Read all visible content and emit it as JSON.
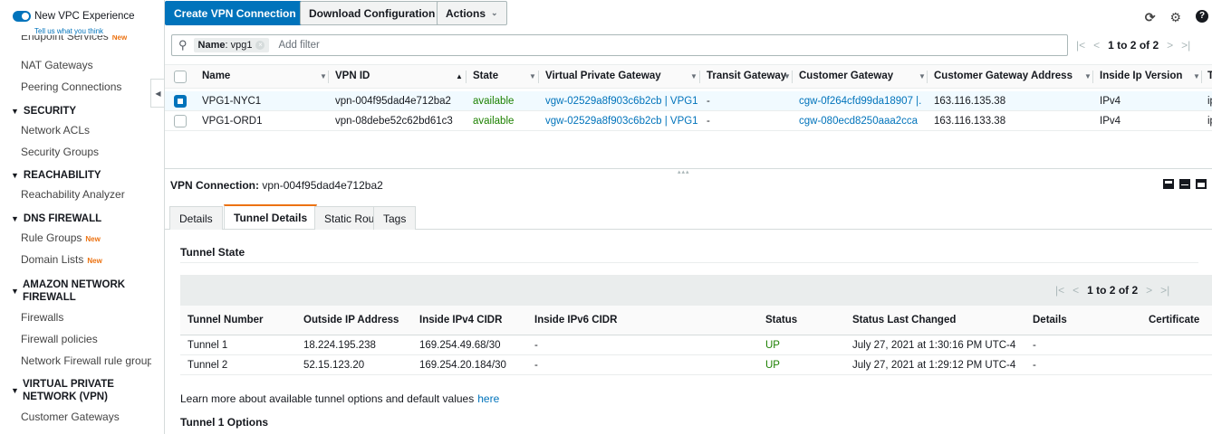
{
  "sidebar": {
    "vpc_toggle_label": "New VPC Experience",
    "feedback_link": "Tell us what you think",
    "cut_item": "Endpoint Services",
    "new_badge": "New",
    "nat_gateways": "NAT Gateways",
    "peering": "Peering Connections",
    "security": "SECURITY",
    "network_acls": "Network ACLs",
    "security_groups": "Security Groups",
    "reachability": "REACHABILITY",
    "reachability_analyzer": "Reachability Analyzer",
    "dns_firewall": "DNS FIREWALL",
    "rule_groups": "Rule Groups",
    "domain_lists": "Domain Lists",
    "network_firewall_line1": "AMAZON NETWORK",
    "network_firewall_line2": "FIREWALL",
    "firewalls": "Firewalls",
    "firewall_policies": "Firewall policies",
    "nf_rule_groups": "Network Firewall rule groups",
    "vpn_line1": "VIRTUAL PRIVATE",
    "vpn_line2": "NETWORK (VPN)",
    "customer_gateways": "Customer Gateways"
  },
  "toolbar": {
    "create": "Create VPN Connection",
    "download": "Download Configuration",
    "actions": "Actions"
  },
  "filter": {
    "token_key": "Name",
    "token_value": ": vpg1",
    "placeholder": "Add filter"
  },
  "pager_top": "1 to 2 of 2",
  "columns": {
    "name": "Name",
    "vpn_id": "VPN ID",
    "state": "State",
    "vgw": "Virtual Private Gateway",
    "tgw": "Transit Gateway",
    "cgw": "Customer Gateway",
    "cgw_addr": "Customer Gateway Address",
    "inside_ip": "Inside Ip Version",
    "t_cut": "T"
  },
  "rows": [
    {
      "name": "VPG1-NYC1",
      "vpn_id": "vpn-004f95dad4e712ba2",
      "state": "available",
      "vgw": "vgw-02529a8f903c6b2cb | VPG1",
      "tgw": "-",
      "cgw": "cgw-0f264cfd99da18907 |...",
      "cgw_addr": "163.116.135.38",
      "inside_ip": "IPv4",
      "t_cut": "ip"
    },
    {
      "name": "VPG1-ORD1",
      "vpn_id": "vpn-08debe52c62bd61c3",
      "state": "available",
      "vgw": "vgw-02529a8f903c6b2cb | VPG1",
      "tgw": "-",
      "cgw": "cgw-080ecd8250aaa2cca ...",
      "cgw_addr": "163.116.133.38",
      "inside_ip": "IPv4",
      "t_cut": "ip"
    }
  ],
  "detail": {
    "label": "VPN Connection:",
    "value": "vpn-004f95dad4e712ba2",
    "tabs": [
      "Details",
      "Tunnel Details",
      "Static Routes",
      "Tags"
    ],
    "tunnel_state": "Tunnel State",
    "pager": "1 to 2 of 2",
    "tunnel_cols": [
      "Tunnel Number",
      "Outside IP Address",
      "Inside IPv4 CIDR",
      "Inside IPv6 CIDR",
      "Status",
      "Status Last Changed",
      "Details",
      "Certificate"
    ],
    "tunnels": [
      {
        "number": "Tunnel 1",
        "outside_ip": "18.224.195.238",
        "inside_v4": "169.254.49.68/30",
        "inside_v6": "-",
        "status": "UP",
        "changed": "July 27, 2021 at 1:30:16 PM UTC-4",
        "details": "-"
      },
      {
        "number": "Tunnel 2",
        "outside_ip": "52.15.123.20",
        "inside_v4": "169.254.20.184/30",
        "inside_v6": "-",
        "status": "UP",
        "changed": "July 27, 2021 at 1:29:12 PM UTC-4",
        "details": "-"
      }
    ],
    "learn_more": "Learn more about available tunnel options and default values",
    "here": "here",
    "options_heading": "Tunnel 1 Options"
  },
  "colors": {
    "accent": "#0073bb",
    "tab_active": "#ec7211",
    "status_ok": "#1d8102"
  },
  "icons": [
    "search-icon",
    "refresh-icon",
    "gear-icon",
    "help-icon",
    "chevron-down-icon",
    "sort-icon"
  ]
}
